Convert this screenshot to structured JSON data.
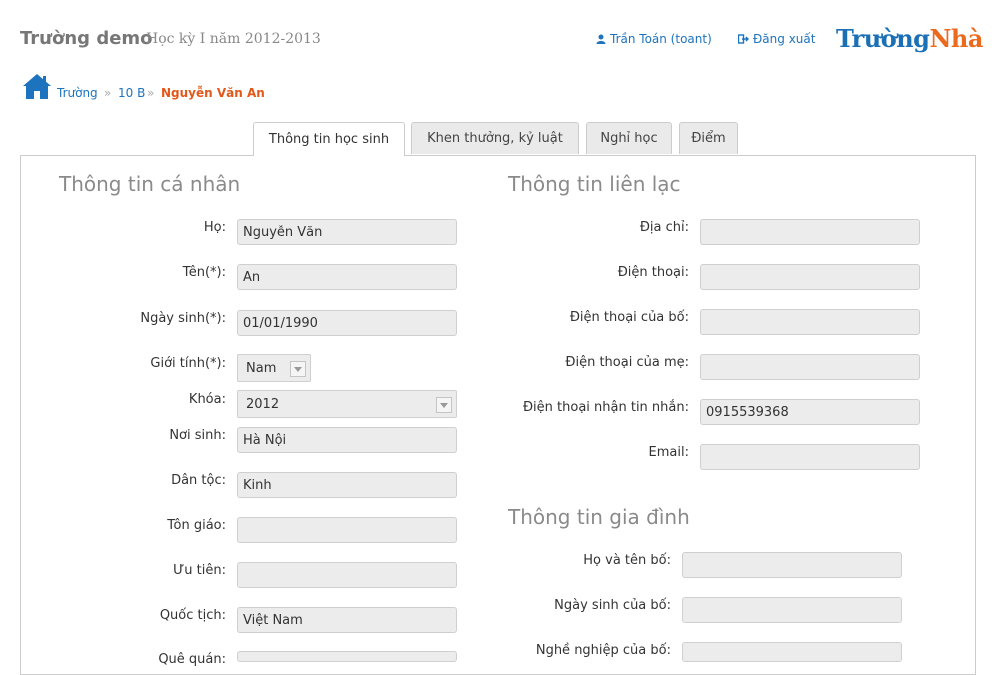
{
  "header": {
    "school_name": "Trường demo",
    "term": "Học kỳ I năm 2012-2013",
    "user_label": "Trần Toán (toant)",
    "logout_label": "Đăng xuất",
    "logo_part1": "Trường",
    "logo_part2": "Nhà",
    "accent": "#1e73be",
    "brand_orange": "#ea6a1e"
  },
  "breadcrumb": {
    "items": [
      "Trường",
      "10 B"
    ],
    "separator": "»",
    "current": "Nguyễn Văn An"
  },
  "tabs": [
    {
      "label": "Thông tin học sinh",
      "active": true
    },
    {
      "label": "Khen thưởng, kỷ luật",
      "active": false
    },
    {
      "label": "Nghỉ học",
      "active": false
    },
    {
      "label": "Điểm",
      "active": false
    }
  ],
  "personal": {
    "title": "Thông tin cá nhân",
    "fields": {
      "ho": {
        "label": "Họ:",
        "value": "Nguyễn Văn"
      },
      "ten": {
        "label": "Tên(*):",
        "value": "An"
      },
      "ngay_sinh": {
        "label": "Ngày sinh(*):",
        "value": "01/01/1990"
      },
      "gioi_tinh": {
        "label": "Giới tính(*):",
        "value": "Nam"
      },
      "khoa": {
        "label": "Khóa:",
        "value": "2012"
      },
      "noi_sinh": {
        "label": "Nơi sinh:",
        "value": "Hà Nội"
      },
      "dan_toc": {
        "label": "Dân tộc:",
        "value": "Kinh"
      },
      "ton_giao": {
        "label": "Tôn giáo:",
        "value": ""
      },
      "uu_tien": {
        "label": "Ưu tiên:",
        "value": ""
      },
      "quoc_tich": {
        "label": "Quốc tịch:",
        "value": "Việt Nam"
      },
      "que_quan": {
        "label": "Quê quán:",
        "value": ""
      }
    }
  },
  "contact": {
    "title": "Thông tin liên lạc",
    "fields": {
      "dia_chi": {
        "label": "Địa chỉ:",
        "value": ""
      },
      "dien_thoai": {
        "label": "Điện thoại:",
        "value": ""
      },
      "dt_bo": {
        "label": "Điện thoại của bố:",
        "value": ""
      },
      "dt_me": {
        "label": "Điện thoại của mẹ:",
        "value": ""
      },
      "dt_tin_nhan": {
        "label": "Điện thoại nhận tin nhắn:",
        "value": "0915539368"
      },
      "email": {
        "label": "Email:",
        "value": ""
      }
    }
  },
  "family": {
    "title": "Thông tin gia đình",
    "fields": {
      "ho_ten_bo": {
        "label": "Họ và tên bố:",
        "value": ""
      },
      "ngay_sinh_bo": {
        "label": "Ngày sinh của bố:",
        "value": ""
      },
      "nghe_nghiep_bo": {
        "label": "Nghề nghiệp của bố:",
        "value": ""
      }
    }
  }
}
